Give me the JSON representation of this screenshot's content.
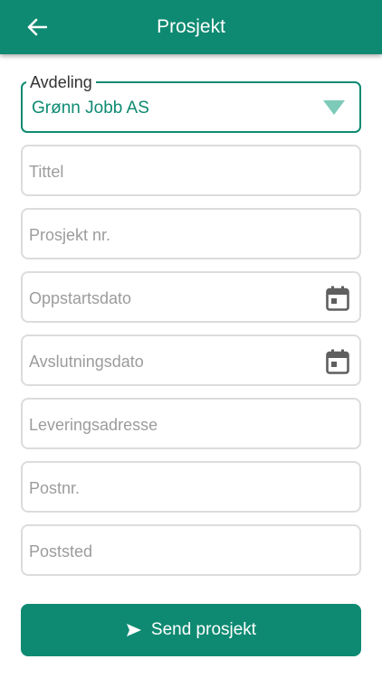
{
  "header": {
    "title": "Prosjekt",
    "back_icon": "arrow-left-icon",
    "background_color": "#0f8a72"
  },
  "form": {
    "department": {
      "label": "Avdeling",
      "value": "Grønn Jobb AS",
      "icon": "triangle-down-icon"
    },
    "title": {
      "placeholder": "Tittel"
    },
    "project_number": {
      "placeholder": "Prosjekt nr."
    },
    "start_date": {
      "placeholder": "Oppstartsdato",
      "icon": "calendar-icon"
    },
    "end_date": {
      "placeholder": "Avslutningsdato",
      "icon": "calendar-icon"
    },
    "delivery_address": {
      "placeholder": "Leveringsadresse"
    },
    "postal_code": {
      "placeholder": "Postnr."
    },
    "city": {
      "placeholder": "Poststed"
    }
  },
  "submit": {
    "label": "Send prosjekt",
    "icon": "send-icon",
    "color": "#0f8a72"
  }
}
